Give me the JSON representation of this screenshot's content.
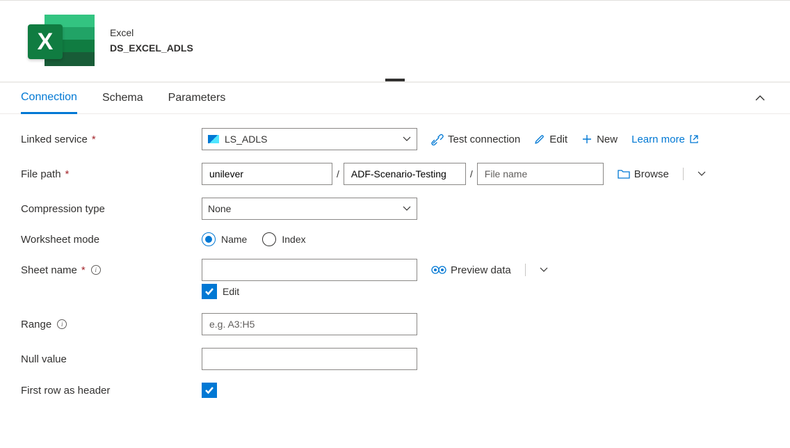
{
  "header": {
    "type_label": "Excel",
    "dataset_name": "DS_EXCEL_ADLS"
  },
  "tabs": {
    "connection": "Connection",
    "schema": "Schema",
    "parameters": "Parameters"
  },
  "labels": {
    "linked_service": "Linked service",
    "file_path": "File path",
    "compression_type": "Compression type",
    "worksheet_mode": "Worksheet mode",
    "sheet_name": "Sheet name",
    "range": "Range",
    "null_value": "Null value",
    "first_row_header": "First row as header"
  },
  "values": {
    "linked_service": "LS_ADLS",
    "file_container": "unilever",
    "file_directory": "ADF-Scenario-Testing",
    "file_name": "",
    "file_name_placeholder": "File name",
    "compression_type": "None",
    "worksheet_mode_name": "Name",
    "worksheet_mode_index": "Index",
    "sheet_name": "",
    "range_placeholder": "e.g. A3:H5",
    "null_value": ""
  },
  "actions": {
    "test_connection": "Test connection",
    "edit": "Edit",
    "new": "New",
    "learn_more": "Learn more",
    "browse": "Browse",
    "preview_data": "Preview data",
    "edit_checkbox": "Edit"
  }
}
